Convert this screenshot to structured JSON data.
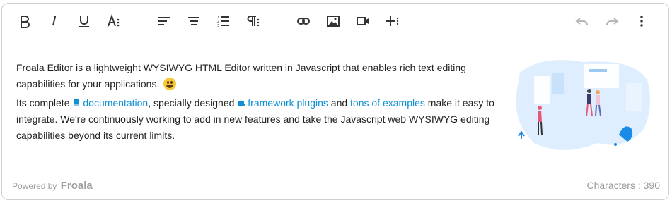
{
  "toolbar": {
    "buttons": [
      {
        "name": "bold-button",
        "icon": "bold-icon"
      },
      {
        "name": "italic-button",
        "icon": "italic-icon"
      },
      {
        "name": "underline-button",
        "icon": "underline-icon"
      },
      {
        "name": "font-size-button",
        "icon": "text-size-icon"
      },
      {
        "name": "align-left-button",
        "icon": "align-left-icon"
      },
      {
        "name": "align-center-button",
        "icon": "align-center-icon"
      },
      {
        "name": "ordered-list-button",
        "icon": "numbered-list-icon"
      },
      {
        "name": "paragraph-format-button",
        "icon": "paragraph-icon"
      },
      {
        "name": "insert-link-button",
        "icon": "link-icon"
      },
      {
        "name": "insert-image-button",
        "icon": "image-icon"
      },
      {
        "name": "insert-video-button",
        "icon": "video-icon"
      },
      {
        "name": "more-insert-button",
        "icon": "plus-more-icon"
      },
      {
        "name": "undo-button",
        "icon": "undo-icon"
      },
      {
        "name": "redo-button",
        "icon": "redo-icon"
      },
      {
        "name": "more-options-button",
        "icon": "kebab-icon"
      }
    ]
  },
  "content": {
    "p1_text": "Froala Editor is a lightweight WYSIWYG HTML Editor written in Javascript that enables rich text editing capabilities for your applications.",
    "p2_text_a": "Its complete ",
    "link_docs": "documentation",
    "p2_text_b": ", specially designed ",
    "link_plugins": "framework plugins",
    "p2_text_c": " and ",
    "link_examples": "tons of examples",
    "p2_text_d": " make it easy to integrate. We're continuously working to add in new features and take the Javascript web WYSIWYG editing capabilities beyond its current limits."
  },
  "footer": {
    "powered_by": "Powered by",
    "brand": "Froala",
    "characters_label": "Characters : 390"
  },
  "colors": {
    "link": "#0f8fd4",
    "icon": "#333333",
    "muted": "#9a9a9a",
    "illustration_blue": "#dfeeff"
  }
}
